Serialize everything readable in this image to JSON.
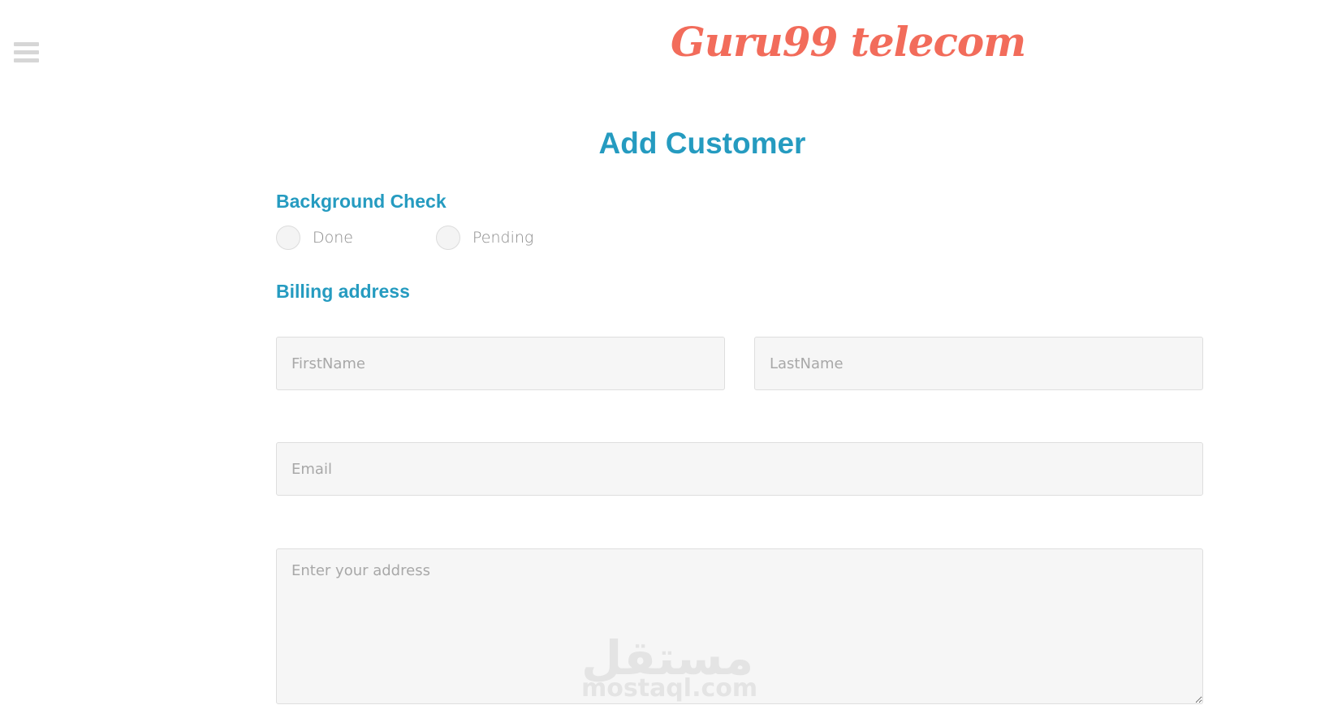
{
  "header": {
    "menu_icon": "hamburger-menu-icon",
    "brand": "Guru99 telecom"
  },
  "page_title": "Add Customer",
  "background_check": {
    "heading": "Background Check",
    "options": [
      {
        "label": "Done",
        "selected": false
      },
      {
        "label": "Pending",
        "selected": false
      }
    ]
  },
  "billing": {
    "heading": "Billing address",
    "first_name_placeholder": "FirstName",
    "last_name_placeholder": "LastName",
    "email_placeholder": "Email",
    "address_placeholder": "Enter your address"
  },
  "watermark": {
    "arabic": "مستقل",
    "latin": "mostaql.com"
  },
  "colors": {
    "brand": "#f26c5b",
    "accent": "#259bc0",
    "field_bg": "#f6f6f6"
  }
}
